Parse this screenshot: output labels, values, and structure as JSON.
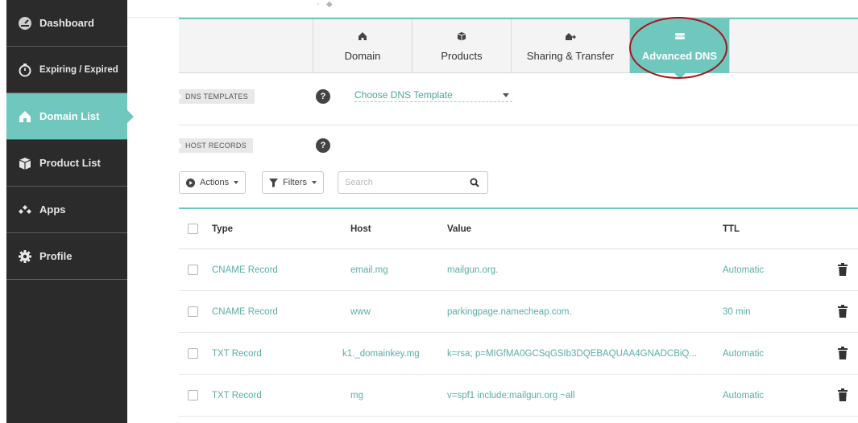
{
  "sidebar": {
    "items": [
      {
        "label": "Dashboard",
        "icon": "dashboard-gauge-icon"
      },
      {
        "label": "Expiring / Expired",
        "icon": "stopwatch-icon"
      },
      {
        "label": "Domain List",
        "icon": "home-icon",
        "active": true
      },
      {
        "label": "Product List",
        "icon": "box-icon"
      },
      {
        "label": "Apps",
        "icon": "apps-diamonds-icon"
      },
      {
        "label": "Profile",
        "icon": "gear-icon"
      }
    ]
  },
  "tabs": [
    {
      "label": "Domain",
      "icon": "home-icon"
    },
    {
      "label": "Products",
      "icon": "box-icon"
    },
    {
      "label": "Sharing & Transfer",
      "icon": "transfer-icon"
    },
    {
      "label": "Advanced DNS",
      "icon": "server-icon",
      "active": true
    }
  ],
  "dns_templates": {
    "tag": "DNS TEMPLATES",
    "help": "?",
    "select_value": "Choose DNS Template"
  },
  "host_records": {
    "tag": "HOST RECORDS",
    "help": "?"
  },
  "toolbar": {
    "actions_label": "Actions",
    "filters_label": "Filters",
    "search_placeholder": "Search"
  },
  "table": {
    "headers": {
      "type": "Type",
      "host": "Host",
      "value": "Value",
      "ttl": "TTL"
    },
    "rows": [
      {
        "type": "CNAME Record",
        "host": "email.mg",
        "value": "mailgun.org.",
        "ttl": "Automatic"
      },
      {
        "type": "CNAME Record",
        "host": "www",
        "value": "parkingpage.namecheap.com.",
        "ttl": "30 min"
      },
      {
        "type": "TXT Record",
        "host": "k1._domainkey.mg",
        "value": "k=rsa; p=MIGfMA0GCSqGSIb3DQEBAQUAA4GNADCBiQ...",
        "ttl": "Automatic"
      },
      {
        "type": "TXT Record",
        "host": "mg",
        "value": "v=spf1 include:mailgun.org ~all",
        "ttl": "Automatic"
      }
    ]
  },
  "colors": {
    "accent": "#6fc7be",
    "sidebar_bg": "#2b2b2b",
    "highlight_ring": "#a8141a"
  }
}
